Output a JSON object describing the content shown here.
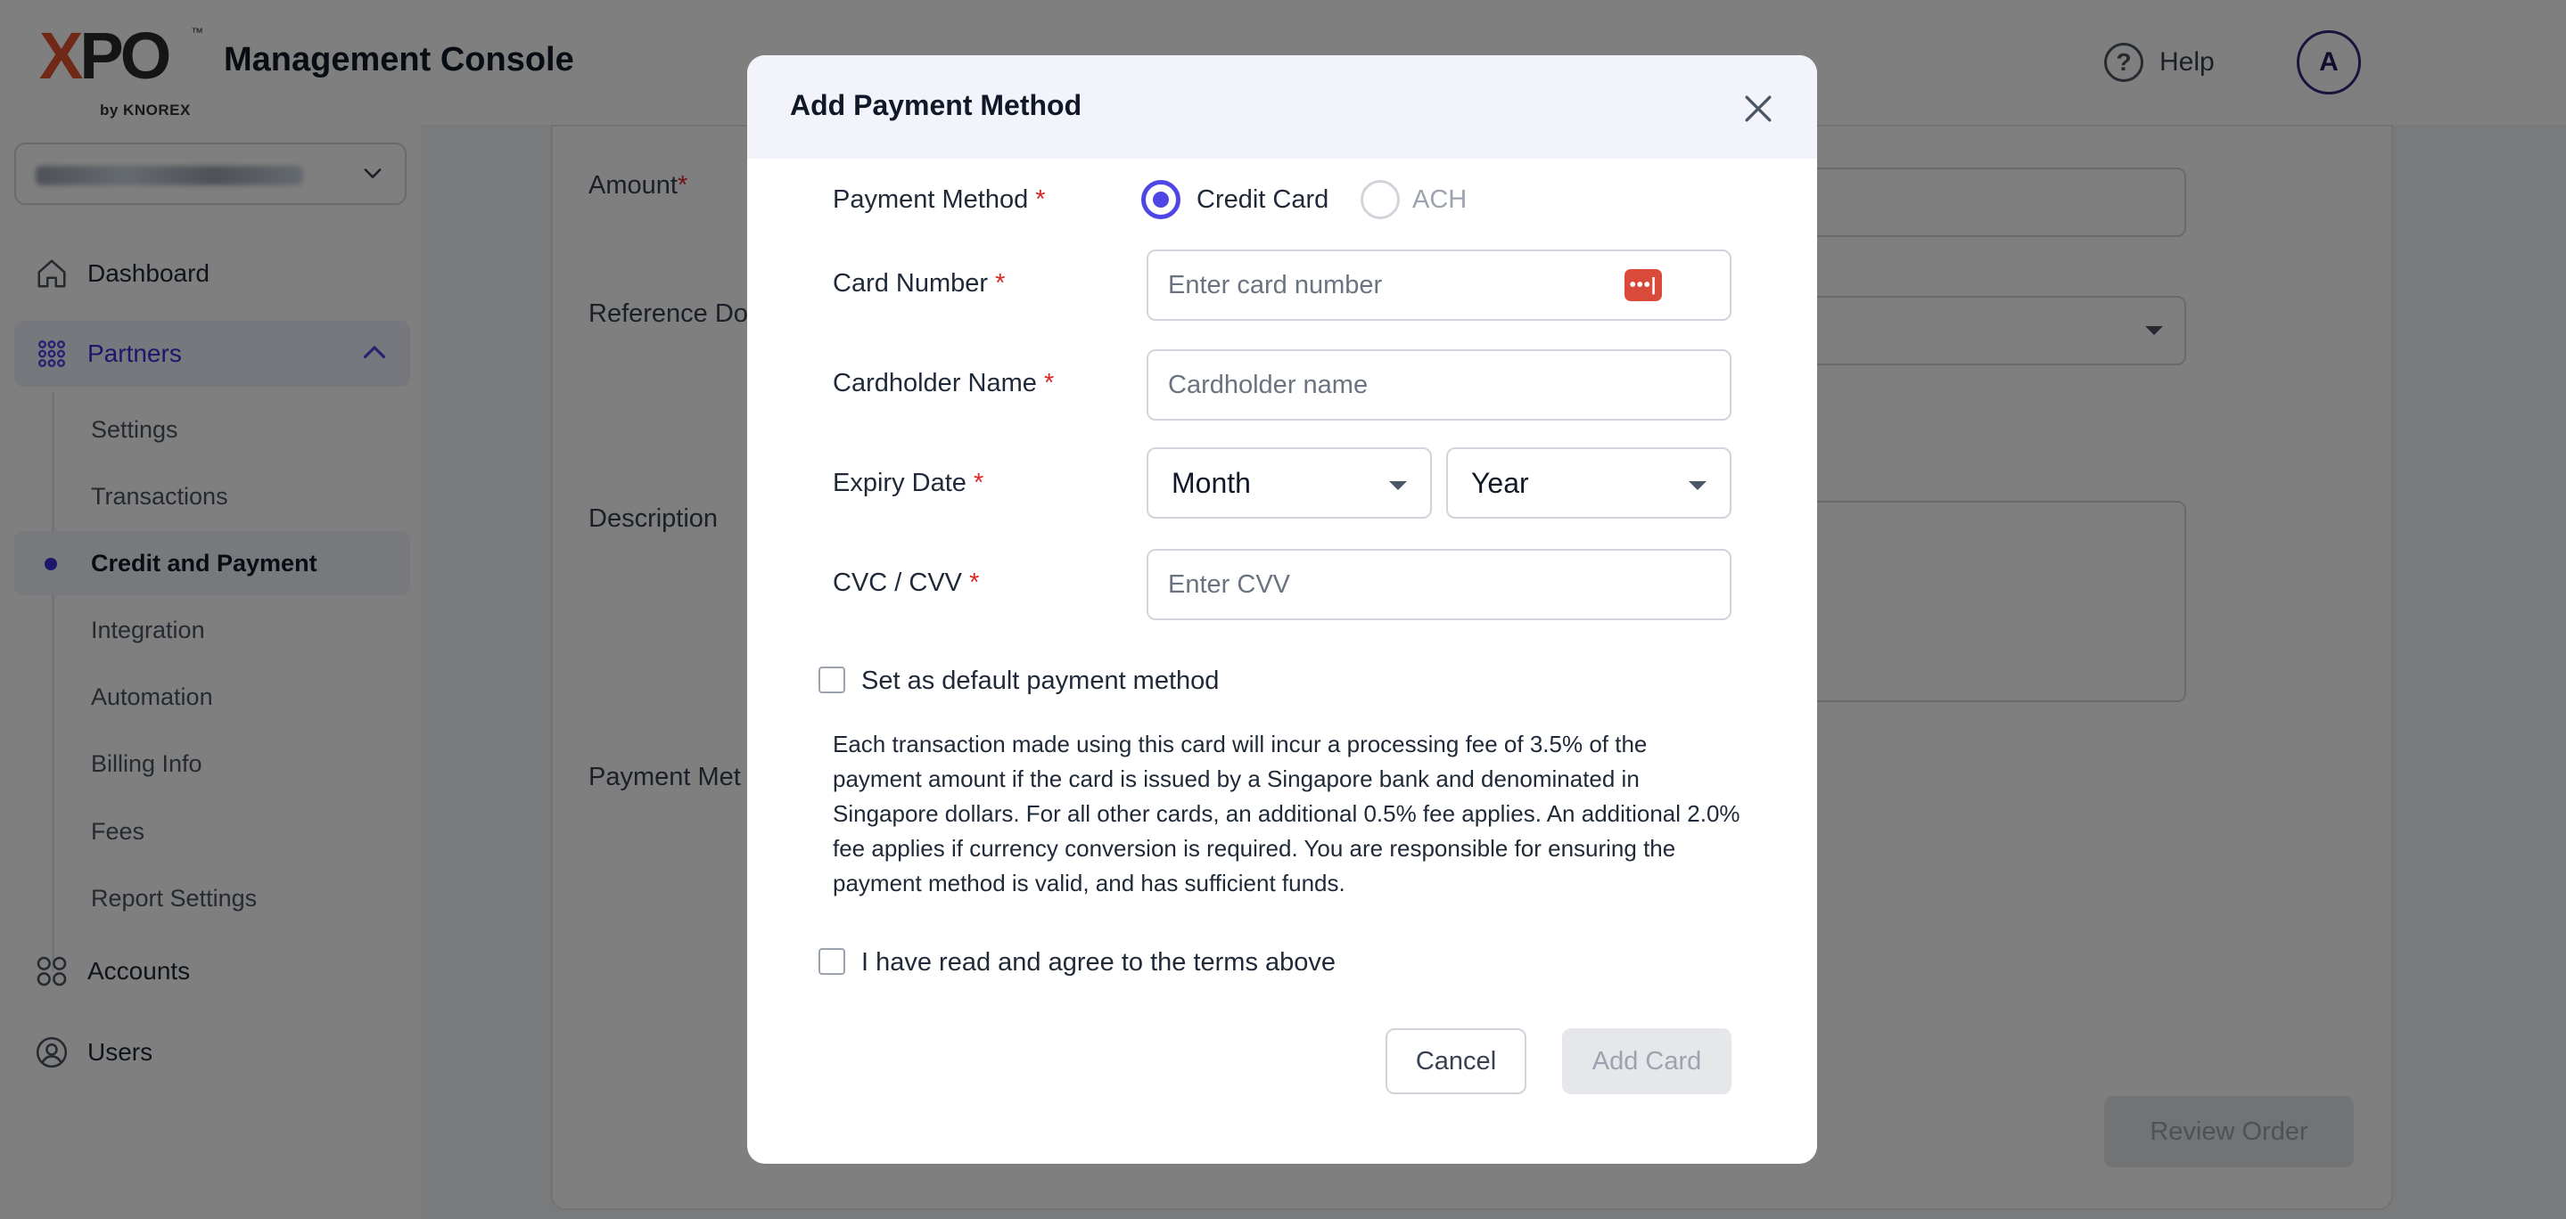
{
  "header": {
    "logo_main_x": "X",
    "logo_main_po": "PO",
    "logo_tm": "™",
    "logo_sub": "by KNOREX",
    "title": "Management Console",
    "help_label": "Help",
    "avatar_initial": "A"
  },
  "sidebar": {
    "account_selector": "Knorex UI Demo Account",
    "items": [
      {
        "label": "Dashboard",
        "icon": "home-icon"
      },
      {
        "label": "Partners",
        "icon": "grid-dots-icon"
      },
      {
        "label": "Accounts",
        "icon": "four-circles-icon"
      },
      {
        "label": "Users",
        "icon": "user-circle-icon"
      }
    ],
    "partner_subitems": [
      "Settings",
      "Transactions",
      "Credit and Payment",
      "Integration",
      "Automation",
      "Billing Info",
      "Fees",
      "Report Settings"
    ],
    "current_subitem": "Credit and Payment"
  },
  "main": {
    "amount_label": "Amount",
    "amount_req": "*",
    "reference_label": "Reference Do",
    "description_label": "Description",
    "payment_method_label": "Payment Met",
    "review_button": "Review Order"
  },
  "modal": {
    "title": "Add Payment Method",
    "payment_method_label": "Payment Method",
    "req": "*",
    "options": [
      {
        "label": "Credit Card",
        "selected": true
      },
      {
        "label": "ACH",
        "selected": false
      }
    ],
    "card_number_label": "Card Number",
    "card_number_placeholder": "Enter card number",
    "password_manager_icon": "•••|",
    "cardholder_label": "Cardholder Name",
    "cardholder_placeholder": "Cardholder name",
    "expiry_label": "Expiry Date",
    "month_value": "Month",
    "year_value": "Year",
    "cvv_label": "CVC / CVV",
    "cvv_placeholder": "Enter CVV",
    "default_checkbox_label": "Set as default payment method",
    "terms_text": "Each transaction made using this card will incur a processing fee of 3.5% of the payment amount if the card is issued by a Singapore bank and denominated in Singapore dollars. For all other cards, an additional 0.5% fee applies. An additional 2.0% fee applies if currency conversion is required. You are responsible for ensuring the payment method is valid, and has sufficient funds.",
    "agree_checkbox_label": "I have read and agree to the terms above",
    "cancel_button": "Cancel",
    "add_button": "Add Card"
  },
  "colors": {
    "accent": "#4f46e5",
    "required": "#dc2626",
    "overlay": "rgba(0,0,0,0.5)"
  }
}
